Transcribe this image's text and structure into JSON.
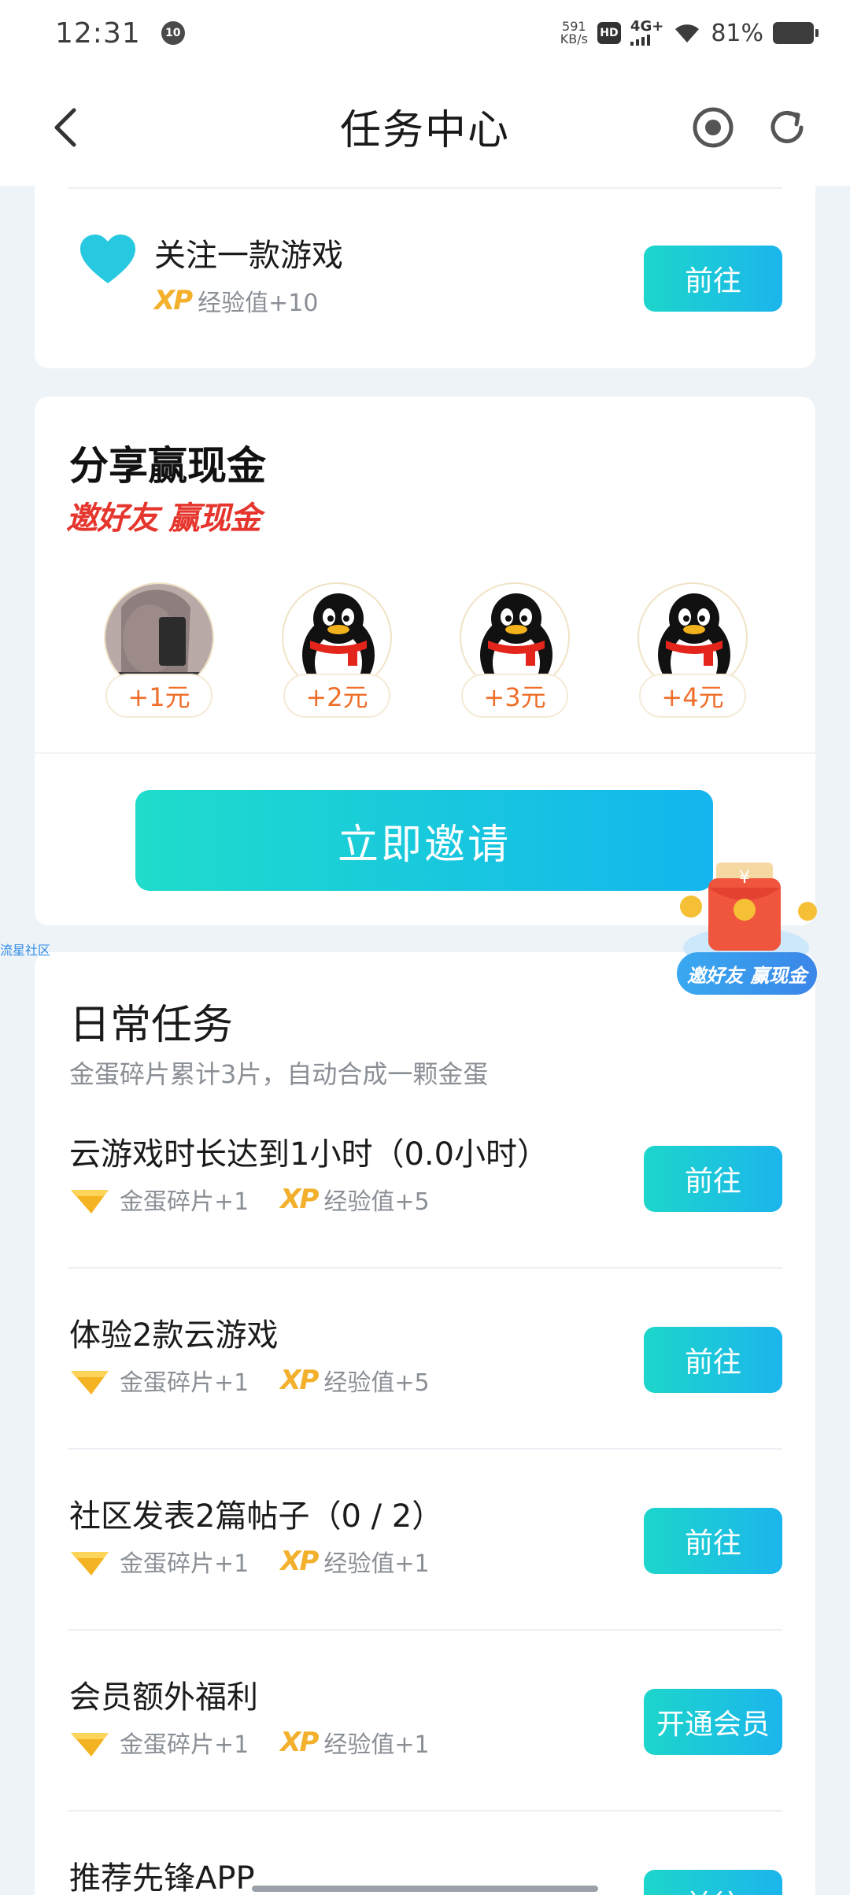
{
  "status_bar": {
    "time": "12:31",
    "notification_badge": "10",
    "speed_value": "591",
    "speed_unit": "KB/s",
    "hd_label": "HD",
    "network_label": "4G+",
    "battery_percent": "81%"
  },
  "header": {
    "title": "任务中心",
    "icons": [
      "back-arrow-icon",
      "record-icon",
      "refresh-icon"
    ]
  },
  "follow_task": {
    "title": "关注一款游戏",
    "xp_label": "XP",
    "reward": "经验值+10",
    "button": "前往"
  },
  "share": {
    "title": "分享赢现金",
    "slogan": "邀好友 赢现金",
    "friends": [
      {
        "amount": "+1元"
      },
      {
        "amount": "+2元"
      },
      {
        "amount": "+3元"
      },
      {
        "amount": "+4元"
      }
    ],
    "invite_button": "立即邀请"
  },
  "floating_badge": {
    "label": "邀好友 赢现金",
    "symbol": "¥"
  },
  "side_link": "流星社区",
  "daily": {
    "title": "日常任务",
    "subtitle": "金蛋碎片累计3片，自动合成一颗金蛋",
    "xp_label": "XP",
    "tasks": [
      {
        "title": "云游戏时长达到1小时（0.0小时）",
        "egg_reward": "金蛋碎片+1",
        "xp_reward": "经验值+5",
        "button": "前往"
      },
      {
        "title": "体验2款云游戏",
        "egg_reward": "金蛋碎片+1",
        "xp_reward": "经验值+5",
        "button": "前往"
      },
      {
        "title": "社区发表2篇帖子（0 / 2）",
        "egg_reward": "金蛋碎片+1",
        "xp_reward": "经验值+1",
        "button": "前往"
      },
      {
        "title": "会员额外福利",
        "egg_reward": "金蛋碎片+1",
        "xp_reward": "经验值+1",
        "button": "开通会员"
      },
      {
        "title": "推荐先锋APP",
        "button": "前往"
      }
    ]
  },
  "colors": {
    "accent_gradient_start": "#1dd6cb",
    "accent_gradient_end": "#1bb5ec",
    "slogan_red": "#e5352d",
    "reward_amount": "#ee6e2a",
    "xp_gold": "#f2b02c"
  }
}
